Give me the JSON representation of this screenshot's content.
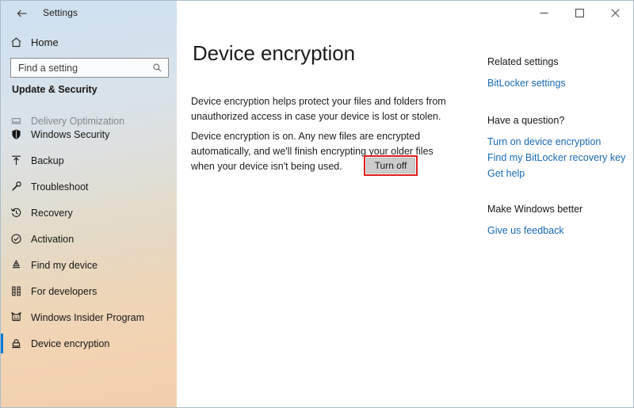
{
  "titlebar": {
    "back_icon": "back-arrow-icon",
    "app_title": "Settings",
    "minimize_label": "minimize-icon",
    "maximize_label": "maximize-icon",
    "close_label": "close-icon"
  },
  "sidebar": {
    "home": {
      "label": "Home",
      "icon": "home-icon"
    },
    "search": {
      "value": "",
      "placeholder": "Find a setting",
      "icon": "search-icon"
    },
    "group_title": "Update & Security",
    "accent_color": "#0078d7",
    "items": [
      {
        "label": "Delivery Optimization",
        "icon": "delivery-optimization-icon",
        "selected": false,
        "clipped": true
      },
      {
        "label": "Windows Security",
        "icon": "shield-icon",
        "selected": false,
        "clipped": false
      },
      {
        "label": "Backup",
        "icon": "backup-upload-icon",
        "selected": false,
        "clipped": false
      },
      {
        "label": "Troubleshoot",
        "icon": "wrench-icon",
        "selected": false,
        "clipped": false
      },
      {
        "label": "Recovery",
        "icon": "history-clock-icon",
        "selected": false,
        "clipped": false
      },
      {
        "label": "Activation",
        "icon": "check-circle-icon",
        "selected": false,
        "clipped": false
      },
      {
        "label": "Find my device",
        "icon": "location-pin-icon",
        "selected": false,
        "clipped": false
      },
      {
        "label": "For developers",
        "icon": "developer-tools-icon",
        "selected": false,
        "clipped": false
      },
      {
        "label": "Windows Insider Program",
        "icon": "insider-ninjacat-icon",
        "selected": false,
        "clipped": false
      },
      {
        "label": "Device encryption",
        "icon": "padlock-icon",
        "selected": true,
        "clipped": false
      }
    ]
  },
  "main": {
    "page_title": "Device encryption",
    "paragraph_1": "Device encryption helps protect your files and folders from unauthorized access in case your device is lost or stolen.",
    "paragraph_2": "Device encryption is on. Any new files are encrypted automatically, and we'll finish encrypting your older files when your device isn't being used.",
    "turn_off_button": "Turn off",
    "highlight_color": "#e01b1b"
  },
  "rail": {
    "related_settings_heading": "Related settings",
    "related_settings_links": [
      {
        "label": "BitLocker settings"
      }
    ],
    "question_heading": "Have a question?",
    "question_links": [
      {
        "label": "Turn on device encryption"
      },
      {
        "label": "Find my BitLocker recovery key"
      },
      {
        "label": "Get help"
      }
    ],
    "feedback_heading": "Make Windows better",
    "feedback_links": [
      {
        "label": "Give us feedback"
      }
    ],
    "link_color": "#1969b2"
  }
}
